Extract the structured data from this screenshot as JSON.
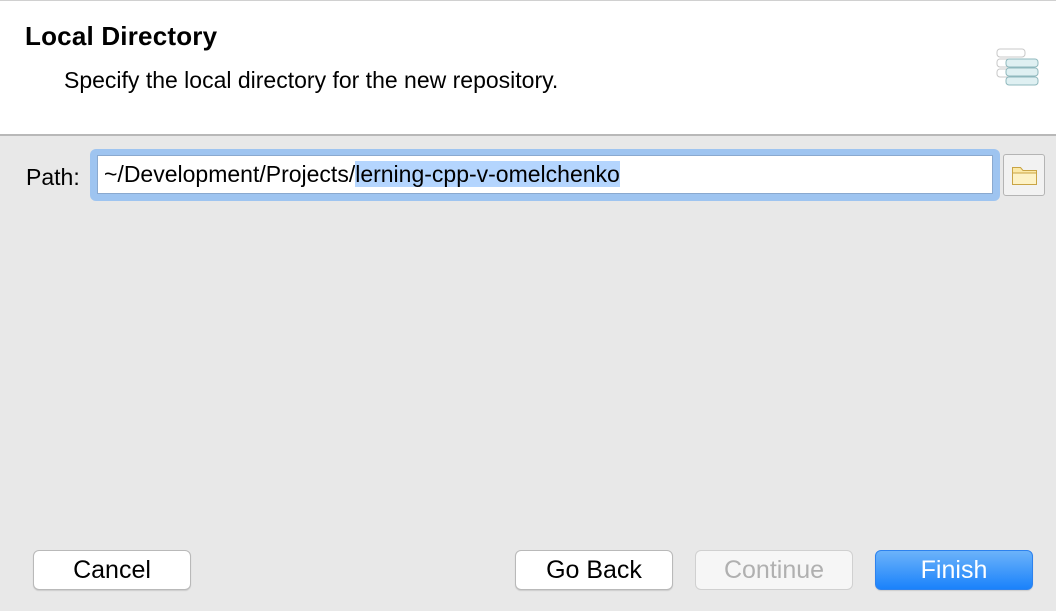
{
  "header": {
    "title": "Local Directory",
    "subtitle": "Specify the local directory for the new repository.",
    "icon": "repository-wizard-icon"
  },
  "path": {
    "label": "Path:",
    "value_prefix": "~/Development/Projects/",
    "value_selected": "lerning-cpp-v-omelchenko",
    "browse_icon": "folder-icon"
  },
  "buttons": {
    "cancel": "Cancel",
    "go_back": "Go Back",
    "continue": "Continue",
    "finish": "Finish"
  },
  "colors": {
    "accent": "#1a82fb",
    "selection": "#b4d5fe",
    "focus_ring": "#9ec4f0"
  }
}
